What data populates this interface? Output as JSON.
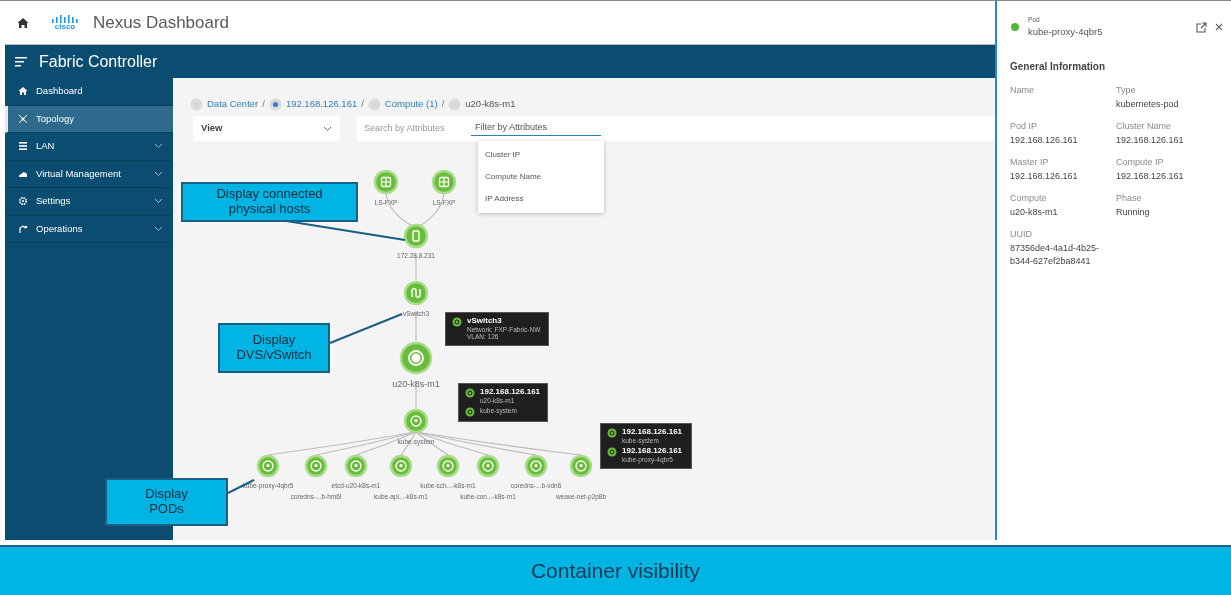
{
  "header": {
    "logo_text": "cisco",
    "title": "Nexus Dashboard"
  },
  "app_bar": {
    "title": "Fabric Controller"
  },
  "sidebar": {
    "items": [
      {
        "label": "Dashboard",
        "kind": "home",
        "selected": false,
        "expandable": false
      },
      {
        "label": "Topology",
        "kind": "topology",
        "selected": true,
        "expandable": false
      },
      {
        "label": "LAN",
        "kind": "list",
        "selected": false,
        "expandable": true
      },
      {
        "label": "Virtual Management",
        "kind": "cloud",
        "selected": false,
        "expandable": true
      },
      {
        "label": "Settings",
        "kind": "gear",
        "selected": false,
        "expandable": true
      },
      {
        "label": "Operations",
        "kind": "operations",
        "selected": false,
        "expandable": true
      }
    ]
  },
  "breadcrumb_separator": "/",
  "breadcrumbs": [
    {
      "label": "Data Center",
      "kind": "site",
      "current": false
    },
    {
      "label": "192.168.126.161",
      "kind": "fabric",
      "current": false
    },
    {
      "label": "Compute (1)",
      "kind": "compute",
      "current": false
    },
    {
      "label": "u20-k8s-m1",
      "kind": "host",
      "current": true
    }
  ],
  "toolbar": {
    "view_select": {
      "value": "View"
    },
    "search": {
      "placeholder": "Search by Attributes"
    },
    "filter": {
      "placeholder": "Filter by Attributes",
      "options": [
        "Cluster IP",
        "Compute Name",
        "IP Address"
      ]
    }
  },
  "topology": {
    "nodes": [
      {
        "kind": "host",
        "label": "LS-FXP"
      },
      {
        "kind": "host",
        "label": "LS-FXP"
      },
      {
        "kind": "switch",
        "label": "172.28.8.231"
      },
      {
        "kind": "vswitch",
        "label": "vSwitch3"
      },
      {
        "kind": "compute",
        "label": "u20-k8s-m1"
      },
      {
        "kind": "namespace",
        "label": "kube-system"
      }
    ],
    "pods": [
      "kube-proxy-4qbr5",
      "coredns-...b-hm6l",
      "etcd-u20-k8s-m1",
      "kube-api...-k8s-m1",
      "kube-sch...-k8s-m1",
      "kube-con...-k8s-m1",
      "coredns-...b-vdn6",
      "weave-net-p2p8b"
    ],
    "tooltips": [
      {
        "entries": [
          {
            "title": "vSwitch3",
            "lines": [
              "Network: FXP-Fabric-NW",
              "VLAN: 126"
            ]
          }
        ]
      },
      {
        "entries": [
          {
            "title": "192.168.126.161",
            "lines": [
              "u20-k8s-m1"
            ]
          },
          {
            "lines": [
              "kube-system"
            ]
          }
        ]
      },
      {
        "entries": [
          {
            "title": "192.168.126.161",
            "lines": [
              "kube-system"
            ]
          },
          {
            "title": "192.168.126.161",
            "lines": [
              "kube-proxy-4qbr5"
            ]
          }
        ]
      }
    ]
  },
  "callouts": [
    "Display connected physical hosts",
    "Display DVS/vSwitch",
    "Display PODs"
  ],
  "details_panel": {
    "kind_label": "Pod",
    "name": "kube-proxy-4qbr5",
    "section": "General Information",
    "fields": [
      {
        "label": "Name"
      },
      {
        "label": "Type",
        "value": "kubernetes-pod"
      },
      {
        "label": "Pod IP",
        "value": "192.168.126.161"
      },
      {
        "label": "Cluster Name",
        "value": "192.168.126.161"
      },
      {
        "label": "Master IP",
        "value": "192.168.126.161"
      },
      {
        "label": "Compute IP",
        "value": "192.168.126.161"
      },
      {
        "label": "Compute",
        "value": "u20-k8s-m1"
      },
      {
        "label": "Phase",
        "value": "Running"
      },
      {
        "label": "UUID",
        "value": "87356de4-4a1d-4b25-b344-627ef2ba8441"
      }
    ]
  },
  "banner": {
    "text": "Container visibility"
  }
}
